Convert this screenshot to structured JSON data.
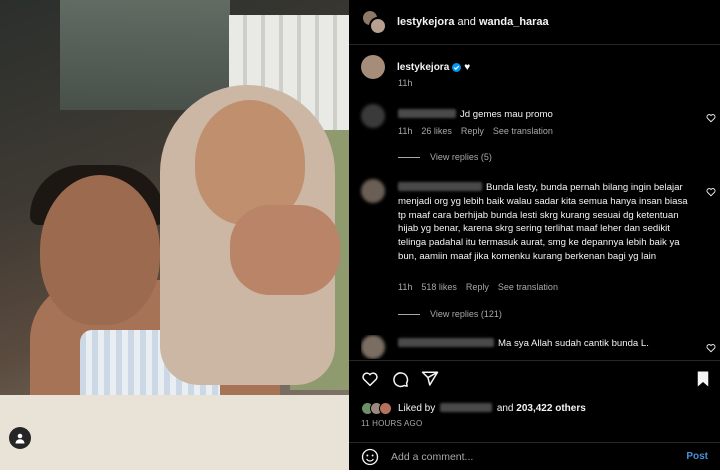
{
  "header": {
    "user1": "lestykejora",
    "joiner": "and",
    "user2": "wanda_haraa"
  },
  "caption": {
    "username": "lestykejora",
    "emoji": "♥",
    "time": "11h"
  },
  "comments": [
    {
      "text": "Jd gemes mau promo",
      "time": "11h",
      "likes": "26 likes",
      "reply": "Reply",
      "see_translation": "See translation",
      "view_replies": "View replies (5)"
    },
    {
      "text": "Bunda lesty, bunda pernah bilang ingin belajar menjadi org yg lebih baik walau sadar kita semua hanya insan biasa tp maaf cara berhijab bunda lesti skrg kurang sesuai dg ketentuan hijab yg benar, karena skrg sering terlihat maaf leher dan sedikit telinga padahal itu termasuk aurat, smg ke depannya lebih baik ya bun, aamiin maaf jika komenku kurang berkenan bagi yg lain",
      "time": "11h",
      "likes": "518 likes",
      "reply": "Reply",
      "see_translation": "See translation",
      "view_replies": "View replies (121)"
    },
    {
      "text": "Ma sya Allah sudah cantik bunda L."
    }
  ],
  "liked_by": {
    "prefix": "Liked by",
    "and": "and",
    "count": "203,422 others"
  },
  "time_ago": "11 HOURS AGO",
  "comment_box": {
    "placeholder": "Add a comment...",
    "post": "Post"
  },
  "icons": [
    "heart-icon",
    "comment-icon",
    "share-icon",
    "bookmark-icon",
    "emoji-icon",
    "user-tag-icon"
  ]
}
